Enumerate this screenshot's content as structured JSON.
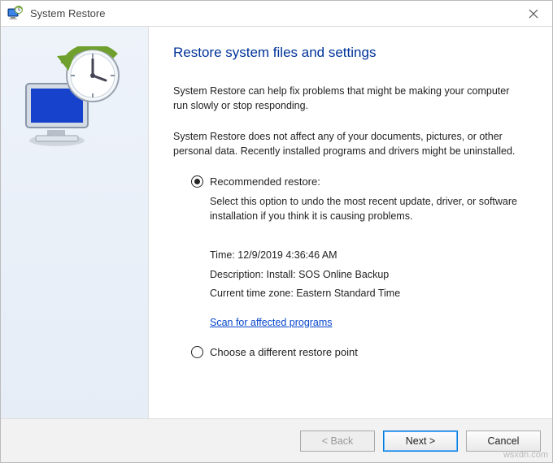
{
  "title": "System Restore",
  "heading": "Restore system files and settings",
  "intro1": "System Restore can help fix problems that might be making your computer run slowly or stop responding.",
  "intro2": "System Restore does not affect any of your documents, pictures, or other personal data. Recently installed programs and drivers might be uninstalled.",
  "recommended": {
    "label": "Recommended restore:",
    "desc": "Select this option to undo the most recent update, driver, or software installation if you think it is causing problems.",
    "time_label": "Time: ",
    "time_value": "12/9/2019 4:36:46 AM",
    "desc_label": "Description: ",
    "desc_value": "Install: SOS Online Backup",
    "tz_label": "Current time zone: ",
    "tz_value": "Eastern Standard Time",
    "scan_link": "Scan for affected programs"
  },
  "choose_label": "Choose a different restore point",
  "buttons": {
    "back": "< Back",
    "next": "Next >",
    "cancel": "Cancel"
  },
  "watermark": "wsxdn.com"
}
